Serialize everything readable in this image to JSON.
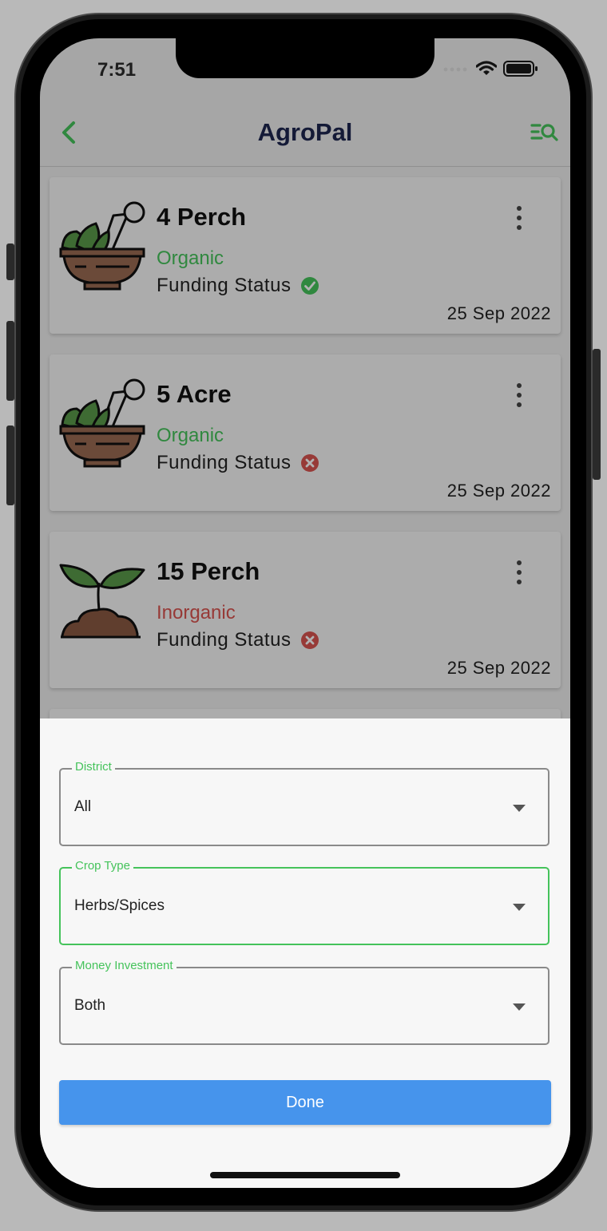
{
  "status_bar": {
    "time": "7:51",
    "signal_icon": "signal-dots-icon",
    "wifi_icon": "wifi-icon",
    "battery_icon": "battery-icon"
  },
  "app_bar": {
    "title": "AgroPal",
    "back_icon": "chevron-left-icon",
    "filter_icon": "filter-search-icon"
  },
  "colors": {
    "accent": "#45c35b",
    "title": "#1e2650",
    "organic": "#45c35b",
    "inorganic": "#d9534f",
    "done_button": "#4694ec",
    "status_ok": "#45c35b",
    "status_fail": "#d9534f"
  },
  "cards": [
    {
      "title": "4 Perch",
      "type": "Organic",
      "funding_label": "Funding Status",
      "funding_ok": true,
      "date": "25 Sep 2022",
      "illustration": "mortar-herbs-icon"
    },
    {
      "title": "5 Acre",
      "type": "Organic",
      "funding_label": "Funding Status",
      "funding_ok": false,
      "date": "25 Sep 2022",
      "illustration": "mortar-herbs-icon"
    },
    {
      "title": "15 Perch",
      "type": "Inorganic",
      "funding_label": "Funding Status",
      "funding_ok": false,
      "date": "25 Sep 2022",
      "illustration": "sprout-icon"
    }
  ],
  "filter_sheet": {
    "fields": [
      {
        "label": "District",
        "value": "All",
        "active": false
      },
      {
        "label": "Crop Type",
        "value": "Herbs/Spices",
        "active": true
      },
      {
        "label": "Money Investment",
        "value": "Both",
        "active": false
      }
    ],
    "done_label": "Done"
  }
}
